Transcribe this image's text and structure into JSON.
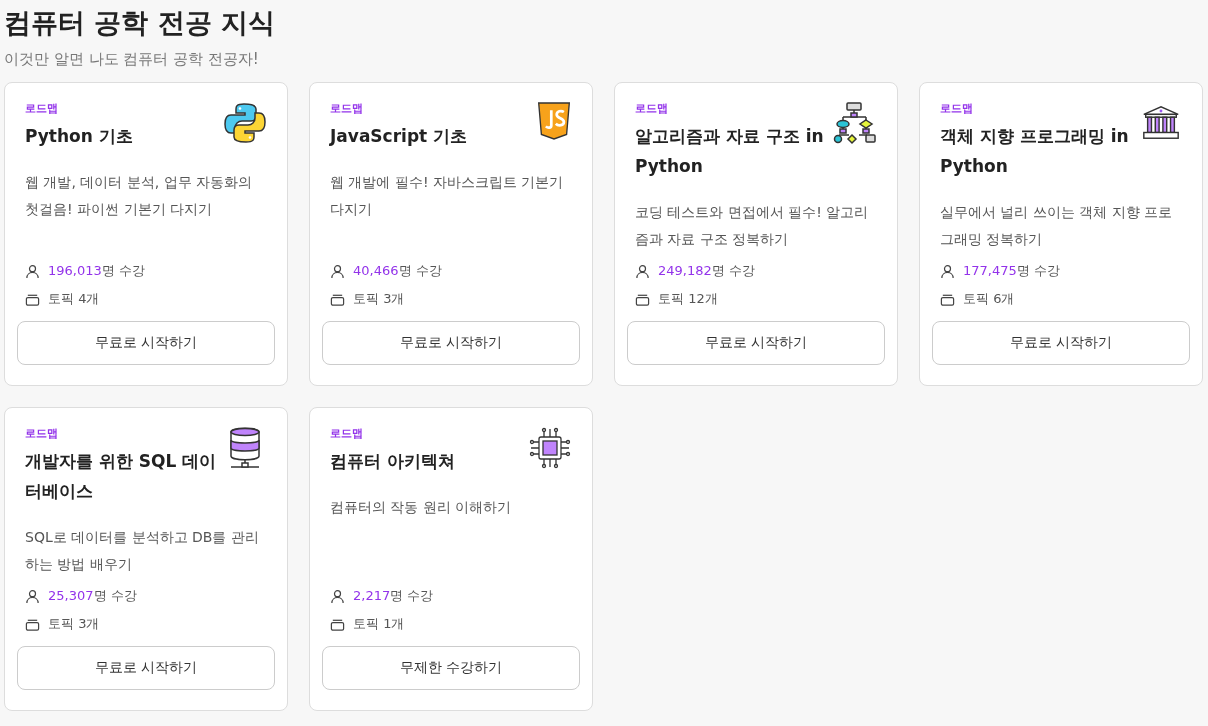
{
  "page": {
    "title": "컴퓨터 공학 전공 지식",
    "subtitle": "이것만 알면 나도 컴퓨터 공학 전공자!"
  },
  "cards": [
    {
      "tag": "로드맵",
      "title": "Python 기초",
      "description": "웹 개발, 데이터 분석, 업무 자동화의 첫걸음! 파이썬 기본기 다지기",
      "learners": "196,013",
      "learners_suffix": "명 수강",
      "topics": "토픽 4개",
      "button": "무료로 시작하기"
    },
    {
      "tag": "로드맵",
      "title": "JavaScript 기초",
      "description": "웹 개발에 필수! 자바스크립트 기본기 다지기",
      "learners": "40,466",
      "learners_suffix": "명 수강",
      "topics": "토픽 3개",
      "button": "무료로 시작하기"
    },
    {
      "tag": "로드맵",
      "title": "알고리즘과 자료 구조 in Python",
      "description": "코딩 테스트와 면접에서 필수! 알고리즘과 자료 구조 정복하기",
      "learners": "249,182",
      "learners_suffix": "명 수강",
      "topics": "토픽 12개",
      "button": "무료로 시작하기"
    },
    {
      "tag": "로드맵",
      "title": "객체 지향 프로그래밍 in Python",
      "description": "실무에서 널리 쓰이는 객체 지향 프로그래밍 정복하기",
      "learners": "177,475",
      "learners_suffix": "명 수강",
      "topics": "토픽 6개",
      "button": "무료로 시작하기"
    },
    {
      "tag": "로드맵",
      "title": "개발자를 위한 SQL 데이터베이스",
      "description": "SQL로 데이터를 분석하고 DB를 관리하는 방법 배우기",
      "learners": "25,307",
      "learners_suffix": "명 수강",
      "topics": "토픽 3개",
      "button": "무료로 시작하기"
    },
    {
      "tag": "로드맵",
      "title": "컴퓨터 아키텍쳐",
      "description": "컴퓨터의 작동 원리 이해하기",
      "learners": "2,217",
      "learners_suffix": "명 수강",
      "topics": "토픽 1개",
      "button": "무제한 수강하기"
    }
  ]
}
